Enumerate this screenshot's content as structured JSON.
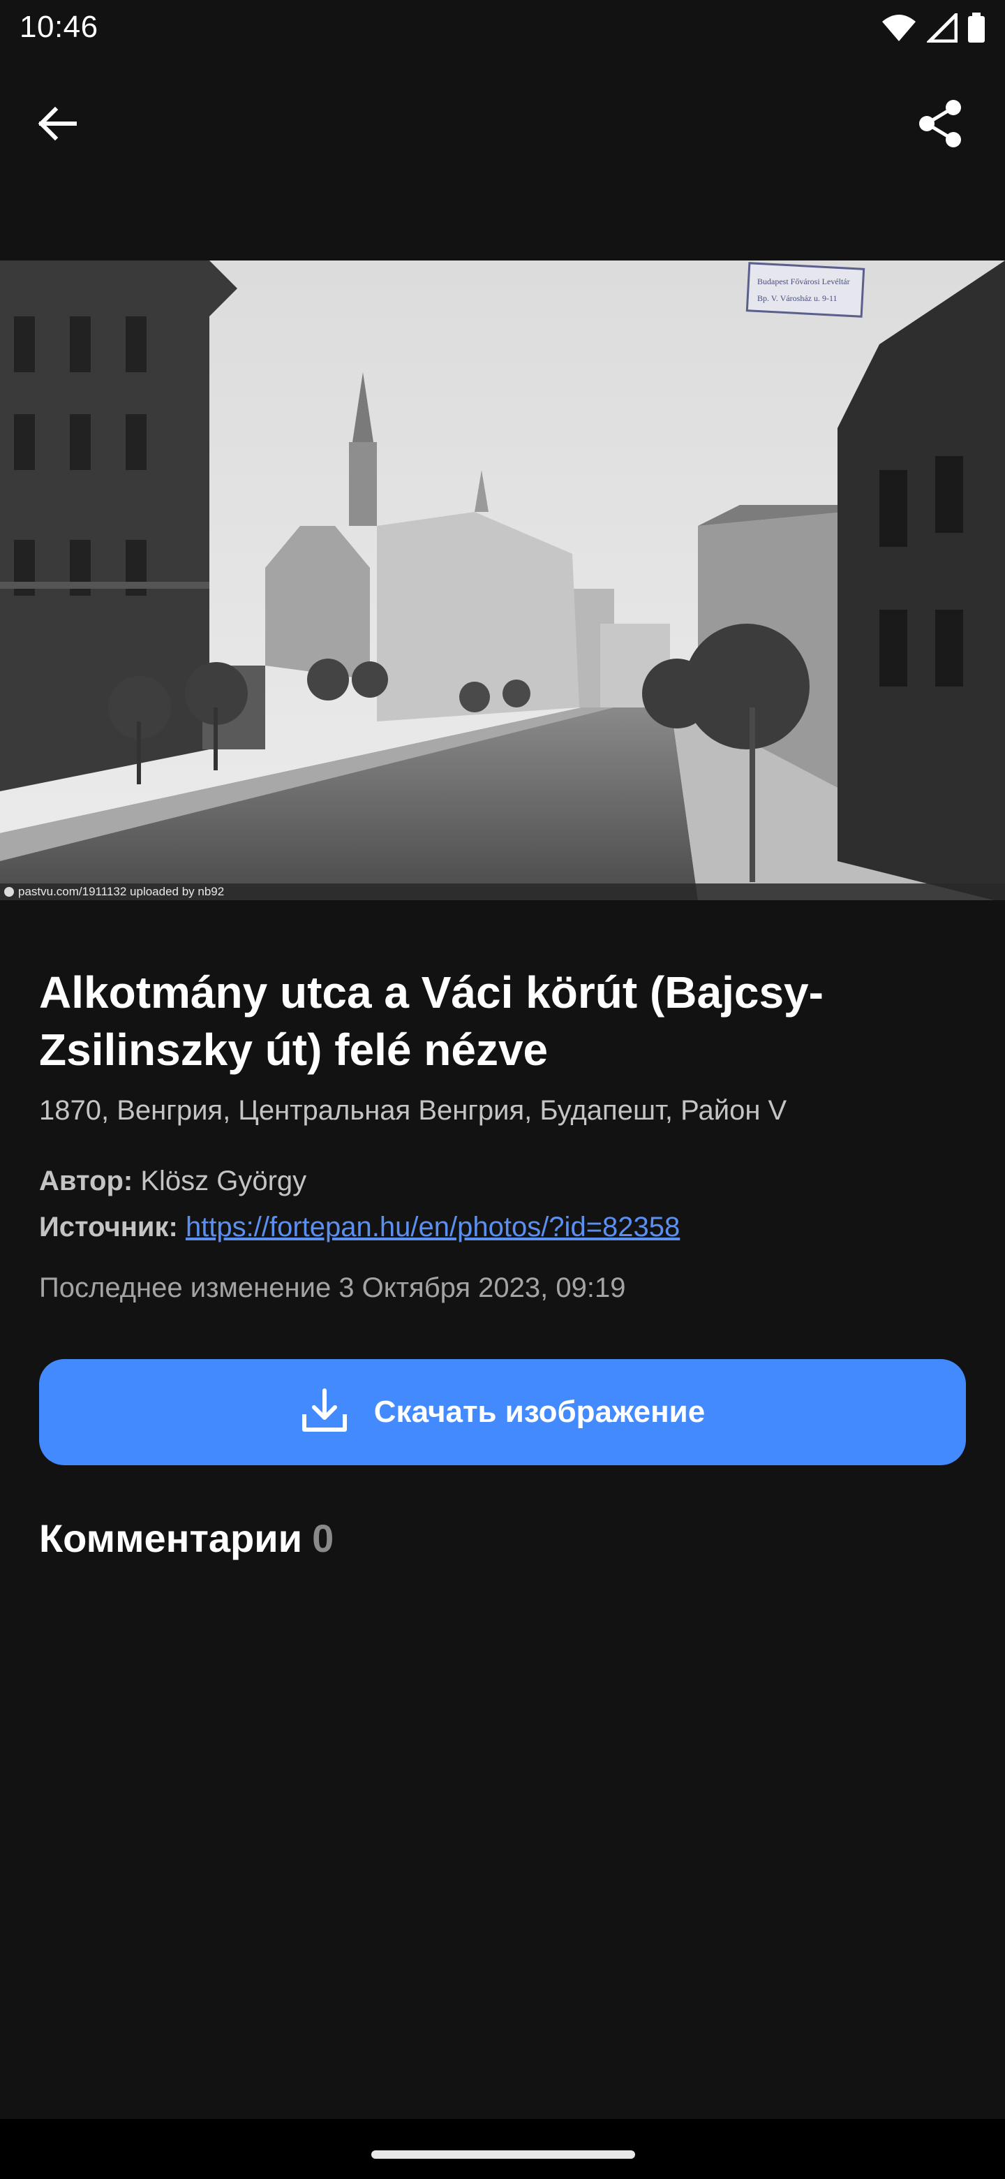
{
  "status_bar": {
    "time": "10:46",
    "icons": [
      "wifi-icon",
      "signal-icon",
      "battery-icon"
    ]
  },
  "app_bar": {
    "back_icon": "arrow-back-icon",
    "share_icon": "share-icon"
  },
  "photo": {
    "description_icon": "historic-street-photo",
    "credit": "pastvu.com/1911132  uploaded by nb92",
    "stamp_line1": "Budapest Fővárosi Levéltár",
    "stamp_line2": "Bp. V. Városház u. 9-11"
  },
  "details": {
    "title": "Alkotmány utca a Váci körút (Bajcsy-Zsilinszky út) felé nézve",
    "location": "1870, Венгрия, Центральная Венгрия, Будапешт, Район V",
    "author_label": "Автор:",
    "author_value": "Klösz György",
    "source_label": "Источник:",
    "source_value": "https://fortepan.hu/en/photos/?id=82358",
    "modified": "Последнее изменение 3 Октября 2023, 09:19"
  },
  "download_button": {
    "label": "Скачать изображение",
    "icon": "download-icon"
  },
  "comments": {
    "label": "Комментарии",
    "count": "0"
  },
  "colors": {
    "background": "#121212",
    "accent": "#448aff",
    "link": "#5b8ff0"
  }
}
